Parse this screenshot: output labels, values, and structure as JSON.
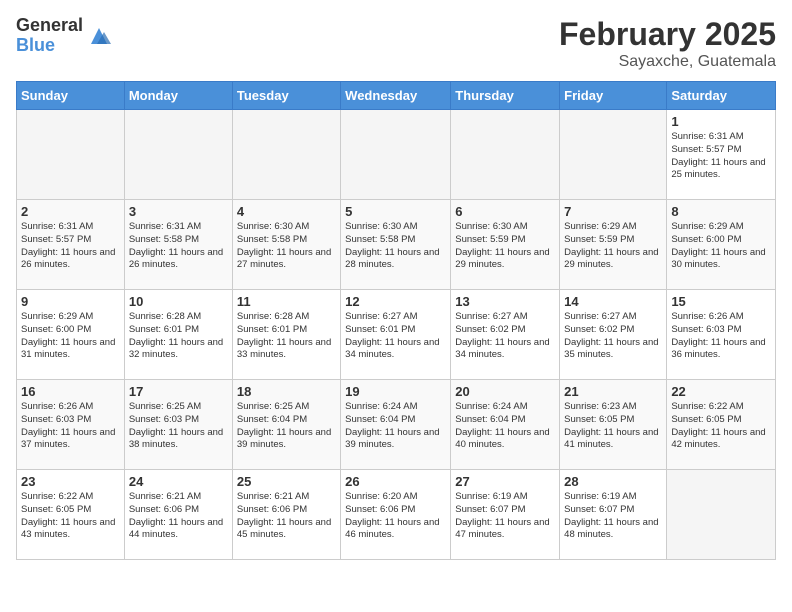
{
  "header": {
    "logo_general": "General",
    "logo_blue": "Blue",
    "month_year": "February 2025",
    "location": "Sayaxche, Guatemala"
  },
  "days_of_week": [
    "Sunday",
    "Monday",
    "Tuesday",
    "Wednesday",
    "Thursday",
    "Friday",
    "Saturday"
  ],
  "weeks": [
    [
      {
        "day": "",
        "info": ""
      },
      {
        "day": "",
        "info": ""
      },
      {
        "day": "",
        "info": ""
      },
      {
        "day": "",
        "info": ""
      },
      {
        "day": "",
        "info": ""
      },
      {
        "day": "",
        "info": ""
      },
      {
        "day": "1",
        "info": "Sunrise: 6:31 AM\nSunset: 5:57 PM\nDaylight: 11 hours and 25 minutes."
      }
    ],
    [
      {
        "day": "2",
        "info": "Sunrise: 6:31 AM\nSunset: 5:57 PM\nDaylight: 11 hours and 26 minutes."
      },
      {
        "day": "3",
        "info": "Sunrise: 6:31 AM\nSunset: 5:58 PM\nDaylight: 11 hours and 26 minutes."
      },
      {
        "day": "4",
        "info": "Sunrise: 6:30 AM\nSunset: 5:58 PM\nDaylight: 11 hours and 27 minutes."
      },
      {
        "day": "5",
        "info": "Sunrise: 6:30 AM\nSunset: 5:58 PM\nDaylight: 11 hours and 28 minutes."
      },
      {
        "day": "6",
        "info": "Sunrise: 6:30 AM\nSunset: 5:59 PM\nDaylight: 11 hours and 29 minutes."
      },
      {
        "day": "7",
        "info": "Sunrise: 6:29 AM\nSunset: 5:59 PM\nDaylight: 11 hours and 29 minutes."
      },
      {
        "day": "8",
        "info": "Sunrise: 6:29 AM\nSunset: 6:00 PM\nDaylight: 11 hours and 30 minutes."
      }
    ],
    [
      {
        "day": "9",
        "info": "Sunrise: 6:29 AM\nSunset: 6:00 PM\nDaylight: 11 hours and 31 minutes."
      },
      {
        "day": "10",
        "info": "Sunrise: 6:28 AM\nSunset: 6:01 PM\nDaylight: 11 hours and 32 minutes."
      },
      {
        "day": "11",
        "info": "Sunrise: 6:28 AM\nSunset: 6:01 PM\nDaylight: 11 hours and 33 minutes."
      },
      {
        "day": "12",
        "info": "Sunrise: 6:27 AM\nSunset: 6:01 PM\nDaylight: 11 hours and 34 minutes."
      },
      {
        "day": "13",
        "info": "Sunrise: 6:27 AM\nSunset: 6:02 PM\nDaylight: 11 hours and 34 minutes."
      },
      {
        "day": "14",
        "info": "Sunrise: 6:27 AM\nSunset: 6:02 PM\nDaylight: 11 hours and 35 minutes."
      },
      {
        "day": "15",
        "info": "Sunrise: 6:26 AM\nSunset: 6:03 PM\nDaylight: 11 hours and 36 minutes."
      }
    ],
    [
      {
        "day": "16",
        "info": "Sunrise: 6:26 AM\nSunset: 6:03 PM\nDaylight: 11 hours and 37 minutes."
      },
      {
        "day": "17",
        "info": "Sunrise: 6:25 AM\nSunset: 6:03 PM\nDaylight: 11 hours and 38 minutes."
      },
      {
        "day": "18",
        "info": "Sunrise: 6:25 AM\nSunset: 6:04 PM\nDaylight: 11 hours and 39 minutes."
      },
      {
        "day": "19",
        "info": "Sunrise: 6:24 AM\nSunset: 6:04 PM\nDaylight: 11 hours and 39 minutes."
      },
      {
        "day": "20",
        "info": "Sunrise: 6:24 AM\nSunset: 6:04 PM\nDaylight: 11 hours and 40 minutes."
      },
      {
        "day": "21",
        "info": "Sunrise: 6:23 AM\nSunset: 6:05 PM\nDaylight: 11 hours and 41 minutes."
      },
      {
        "day": "22",
        "info": "Sunrise: 6:22 AM\nSunset: 6:05 PM\nDaylight: 11 hours and 42 minutes."
      }
    ],
    [
      {
        "day": "23",
        "info": "Sunrise: 6:22 AM\nSunset: 6:05 PM\nDaylight: 11 hours and 43 minutes."
      },
      {
        "day": "24",
        "info": "Sunrise: 6:21 AM\nSunset: 6:06 PM\nDaylight: 11 hours and 44 minutes."
      },
      {
        "day": "25",
        "info": "Sunrise: 6:21 AM\nSunset: 6:06 PM\nDaylight: 11 hours and 45 minutes."
      },
      {
        "day": "26",
        "info": "Sunrise: 6:20 AM\nSunset: 6:06 PM\nDaylight: 11 hours and 46 minutes."
      },
      {
        "day": "27",
        "info": "Sunrise: 6:19 AM\nSunset: 6:07 PM\nDaylight: 11 hours and 47 minutes."
      },
      {
        "day": "28",
        "info": "Sunrise: 6:19 AM\nSunset: 6:07 PM\nDaylight: 11 hours and 48 minutes."
      },
      {
        "day": "",
        "info": ""
      }
    ]
  ]
}
